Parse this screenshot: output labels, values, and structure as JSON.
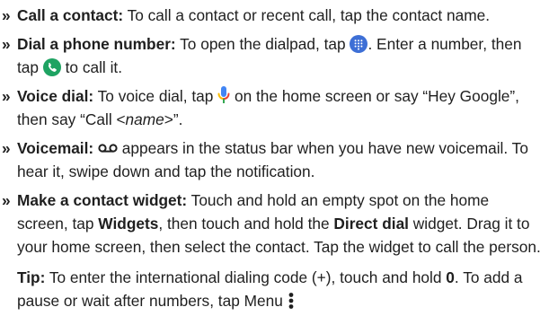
{
  "items": [
    {
      "label": "Call a contact:",
      "text": " To call a contact or recent call, tap the contact name."
    },
    {
      "label": "Dial a phone number:",
      "text_1": " To open the dialpad, tap ",
      "text_2": ". Enter a number, then tap ",
      "text_3": " to call it."
    },
    {
      "label": "Voice dial:",
      "text_1": " To voice dial, tap ",
      "text_2": " on the home screen or say “Hey Google”, then say “Call <",
      "name": "name",
      "text_3": ">”."
    },
    {
      "label": "Voicemail:",
      "text_1": " ",
      "text_2": " appears in the status bar when you have new voicemail. To hear it, swipe down and tap the notification."
    },
    {
      "label": "Make a contact widget:",
      "text_1": " Touch and hold an empty spot on the home screen, tap ",
      "bold_1": "Widgets",
      "text_2": ", then touch and hold the ",
      "bold_2": "Direct dial",
      "text_3": " widget. Drag it to your home screen, then select the contact. Tap the widget to call the person."
    }
  ],
  "bullet_symbol": "»",
  "tip": {
    "label": "Tip:",
    "text_1": " To enter the international dialing code (+), touch and hold ",
    "bold_1": "0",
    "text_2": ". To add a pause or wait after numbers, tap Menu "
  },
  "icons": {
    "dialpad": "dialpad-icon",
    "call": "phone-call-icon",
    "mic": "microphone-icon",
    "voicemail": "voicemail-icon",
    "menu": "more-vertical-icon"
  },
  "colors": {
    "dialpad_blue": "#3d6fd6",
    "call_green": "#1ea362",
    "mic_blue": "#4285f4",
    "mic_red": "#ea4335",
    "mic_yellow": "#fbbc04",
    "mic_green": "#34a853",
    "text": "#1f1f1f"
  }
}
